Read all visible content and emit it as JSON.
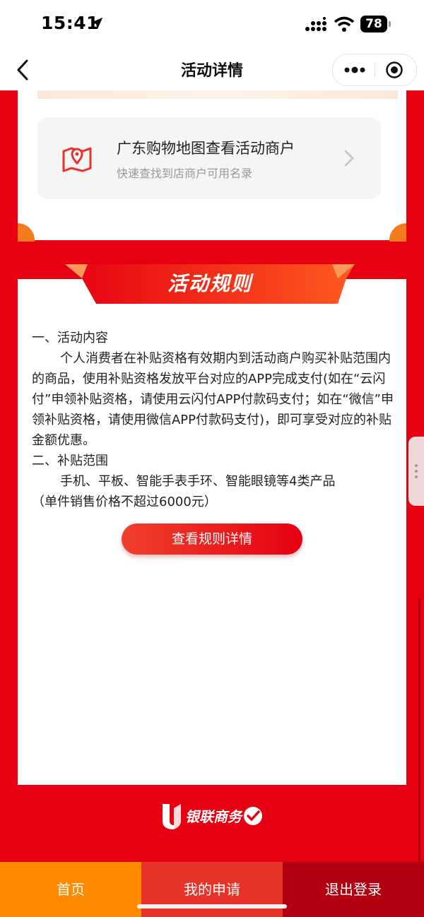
{
  "status_bar": {
    "time": "15:41",
    "battery": "78",
    "icons": [
      "location-arrow-icon",
      "signal-icon",
      "wifi-icon",
      "battery-icon"
    ]
  },
  "nav": {
    "title": "活动详情",
    "icons": [
      "back-icon",
      "more-icon",
      "target-icon"
    ]
  },
  "map_entry": {
    "title": "广东购物地图查看活动商户",
    "subtitle": "快速查找到店商户可用名录",
    "icon": "map-pin-icon"
  },
  "rules": {
    "banner": "活动规则",
    "section1_title": "一、活动内容",
    "section1_body": "个人消费者在补贴资格有效期内到活动商户购买补贴范围内的商品，使用补贴资格发放平台对应的APP完成支付(如在“云闪付”申领补贴资格，请使用云闪付APP付款码支付；如在“微信”申领补贴资格，请使用微信APP付款码支付)，即可享受对应的补贴金额优惠。",
    "section2_title": "二、补贴范围",
    "section2_body": "手机、平板、智能手表手环、智能眼镜等4类产品",
    "section2_note": "（单件销售价格不超过6000元）",
    "detail_button": "查看规则详情"
  },
  "footer": {
    "logo_text": "银联商务",
    "logo_small": "UMS"
  },
  "tabs": [
    {
      "label": "首页"
    },
    {
      "label": "我的申请"
    },
    {
      "label": "退出登录"
    }
  ],
  "colors": {
    "brand_red": "#e60012",
    "tab_home": "#ff8a00",
    "tab_apply": "#e8332a",
    "tab_logout": "#b30010"
  }
}
